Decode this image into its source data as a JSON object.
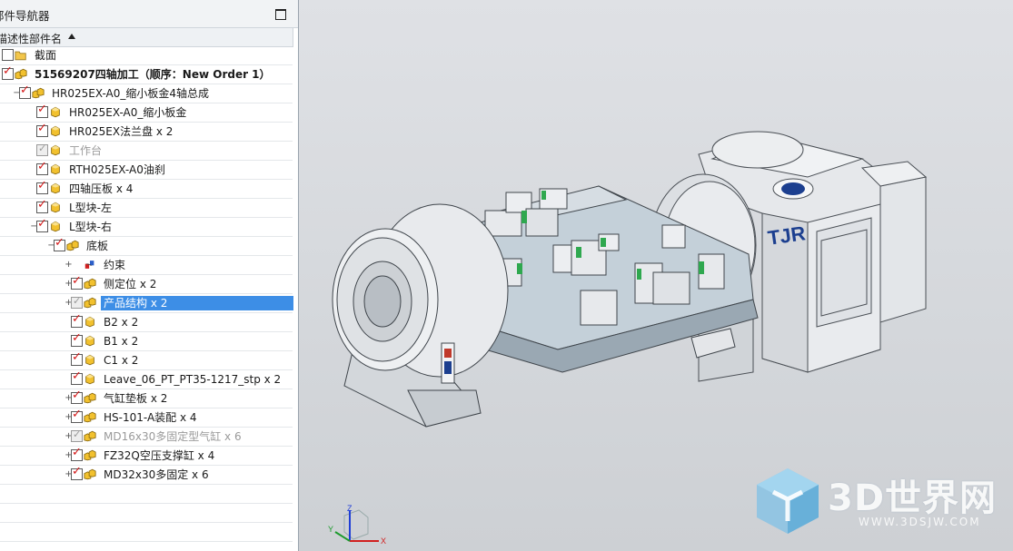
{
  "navigator": {
    "title": "部件导航器",
    "column_header": "描述性部件名",
    "items": [
      {
        "label": "截面",
        "level": 0,
        "checkbox": "unchecked",
        "icon": "folder-icon",
        "expand": "none",
        "style": "normal"
      },
      {
        "label": "51569207四轴加工（顺序：New Order 1）",
        "level": 0,
        "checkbox": "checked",
        "icon": "assembly-icon",
        "expand": "none",
        "style": "bold"
      },
      {
        "label": "HR025EX-A0_缩小板金4轴总成",
        "level": 1,
        "checkbox": "checked",
        "icon": "assembly-icon",
        "expand": "collapse",
        "style": "normal"
      },
      {
        "label": "HR025EX-A0_缩小板金",
        "level": 2,
        "checkbox": "checked",
        "icon": "part-icon",
        "expand": "none",
        "style": "normal"
      },
      {
        "label": "HR025EX法兰盘 x 2",
        "level": 2,
        "checkbox": "checked",
        "icon": "part-icon",
        "expand": "none",
        "style": "normal"
      },
      {
        "label": "工作台",
        "level": 2,
        "checkbox": "grey",
        "icon": "part-icon",
        "expand": "none",
        "style": "dim"
      },
      {
        "label": "RTH025EX-A0油刹",
        "level": 2,
        "checkbox": "checked",
        "icon": "part-icon",
        "expand": "none",
        "style": "normal"
      },
      {
        "label": "四轴压板 x 4",
        "level": 2,
        "checkbox": "checked",
        "icon": "part-icon",
        "expand": "none",
        "style": "normal"
      },
      {
        "label": "L型块-左",
        "level": 2,
        "checkbox": "checked",
        "icon": "part-icon",
        "expand": "none",
        "style": "normal"
      },
      {
        "label": "L型块-右",
        "level": 2,
        "checkbox": "checked",
        "icon": "part-icon",
        "expand": "collapse",
        "style": "normal"
      },
      {
        "label": "底板",
        "level": 3,
        "checkbox": "checked",
        "icon": "assembly-icon",
        "expand": "collapse",
        "style": "normal"
      },
      {
        "label": "约束",
        "level": 4,
        "checkbox": "none",
        "icon": "constraint-icon",
        "expand": "expand",
        "style": "normal"
      },
      {
        "label": "侧定位 x 2",
        "level": 4,
        "checkbox": "checked",
        "icon": "assembly-icon",
        "expand": "expand",
        "style": "normal"
      },
      {
        "label": "产品结构 x 2",
        "level": 4,
        "checkbox": "grey",
        "icon": "assembly-icon",
        "expand": "expand",
        "style": "selected"
      },
      {
        "label": "B2 x 2",
        "level": 4,
        "checkbox": "checked",
        "icon": "part-icon",
        "expand": "none",
        "style": "normal"
      },
      {
        "label": "B1 x 2",
        "level": 4,
        "checkbox": "checked",
        "icon": "part-icon",
        "expand": "none",
        "style": "normal"
      },
      {
        "label": "C1 x 2",
        "level": 4,
        "checkbox": "checked",
        "icon": "part-icon",
        "expand": "none",
        "style": "normal"
      },
      {
        "label": "Leave_06_PT_PT35-1217_stp x 2",
        "level": 4,
        "checkbox": "checked",
        "icon": "part-icon",
        "expand": "none",
        "style": "normal"
      },
      {
        "label": "气缸垫板 x 2",
        "level": 4,
        "checkbox": "checked",
        "icon": "assembly-icon",
        "expand": "expand",
        "style": "normal"
      },
      {
        "label": "HS-101-A装配 x 4",
        "level": 4,
        "checkbox": "checked",
        "icon": "assembly-icon",
        "expand": "expand",
        "style": "normal"
      },
      {
        "label": "MD16x30多固定型气缸 x 6",
        "level": 4,
        "checkbox": "grey",
        "icon": "assembly-icon",
        "expand": "expand",
        "style": "dim"
      },
      {
        "label": "FZ32Q空压支撑缸 x 4",
        "level": 4,
        "checkbox": "checked",
        "icon": "assembly-icon",
        "expand": "expand",
        "style": "normal"
      },
      {
        "label": "MD32x30多固定 x 6",
        "level": 4,
        "checkbox": "checked",
        "icon": "assembly-icon",
        "expand": "expand",
        "style": "normal"
      }
    ]
  },
  "viewport": {
    "logo_text": "TJR",
    "triad": {
      "x": "X",
      "y": "Y",
      "z": "Z"
    }
  },
  "watermark": {
    "text": "3D世界网",
    "url": "WWW.3DSJW.COM"
  },
  "colors": {
    "selection": "#3d8ee6",
    "check": "#d41a1a",
    "part_yellow": "#f2c12e",
    "model_grey": "#e4e6e9",
    "accent_green": "#2fa84f"
  }
}
